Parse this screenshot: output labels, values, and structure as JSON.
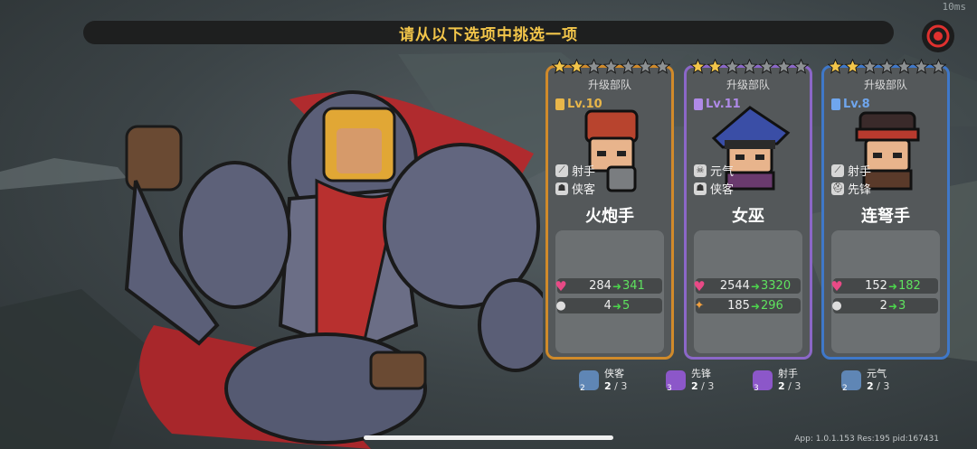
{
  "header": {
    "title": "请从以下选项中挑选一项",
    "timer": "10ms"
  },
  "colors": {
    "gold": "#f2c54a",
    "orange_border": "#d08a2a",
    "purple_border": "#8b67c8",
    "blue_border": "#3f78c9",
    "stat_up": "#5fe35f"
  },
  "cards": [
    {
      "stars_filled": 2,
      "stars_total": 7,
      "upgrade_label": "升级部队",
      "level": "Lv.10",
      "level_color": "#e8b64a",
      "traits": [
        {
          "icon": "crossbow-icon",
          "label": "射手"
        },
        {
          "icon": "cloak-icon",
          "label": "侠客"
        }
      ],
      "name": "火炮手",
      "stats": [
        {
          "icon": "heart-icon",
          "old": "284",
          "new": "341"
        },
        {
          "icon": "person-icon",
          "old": "4",
          "new": "5"
        }
      ]
    },
    {
      "stars_filled": 2,
      "stars_total": 7,
      "upgrade_label": "升级部队",
      "level": "Lv.11",
      "level_color": "#b08ae8",
      "traits": [
        {
          "icon": "skull-icon",
          "label": "元气"
        },
        {
          "icon": "cloak-icon",
          "label": "侠客"
        }
      ],
      "name": "女巫",
      "stats": [
        {
          "icon": "heart-icon",
          "old": "2544",
          "new": "3320"
        },
        {
          "icon": "wand-icon",
          "old": "185",
          "new": "296"
        }
      ]
    },
    {
      "stars_filled": 2,
      "stars_total": 7,
      "upgrade_label": "升级部队",
      "level": "Lv.8",
      "level_color": "#6fa6ee",
      "traits": [
        {
          "icon": "crossbow-icon",
          "label": "射手"
        },
        {
          "icon": "helmet-icon",
          "label": "先锋"
        }
      ],
      "name": "连弩手",
      "stats": [
        {
          "icon": "heart-icon",
          "old": "152",
          "new": "182"
        },
        {
          "icon": "person-icon",
          "old": "2",
          "new": "3"
        }
      ]
    }
  ],
  "synergies": [
    {
      "icon": "cloak-icon",
      "level": "2",
      "label": "侠客",
      "current": "2",
      "total": "/ 3",
      "color": "#5f86b5"
    },
    {
      "icon": "helmet-icon",
      "level": "3",
      "label": "先锋",
      "current": "2",
      "total": "/ 3",
      "color": "#8c57c9"
    },
    {
      "icon": "crossbow-icon",
      "level": "3",
      "label": "射手",
      "current": "2",
      "total": "/ 3",
      "color": "#8c57c9"
    },
    {
      "icon": "skull-icon",
      "level": "2",
      "label": "元气",
      "current": "2",
      "total": "/ 3",
      "color": "#5f86b5"
    }
  ],
  "footer": "App: 1.0.1.153 Res:195 pid:167431"
}
